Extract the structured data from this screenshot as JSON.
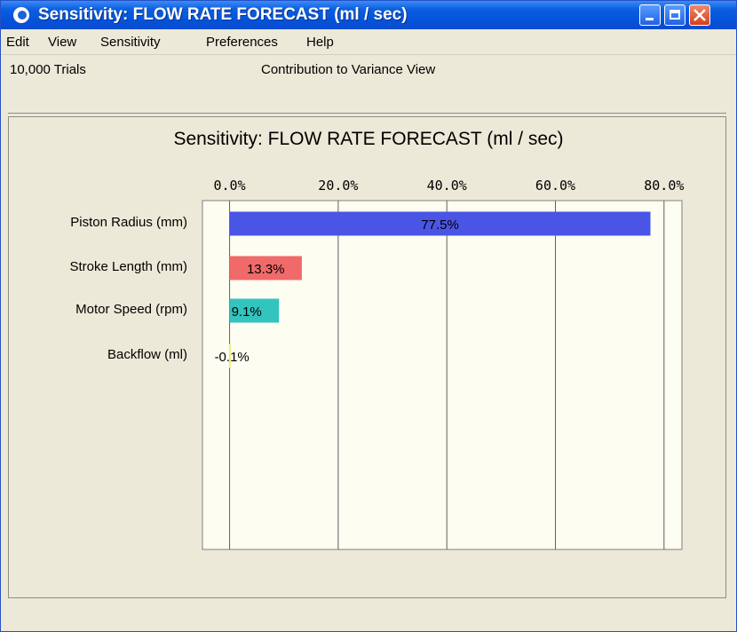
{
  "window": {
    "title": "Sensitivity: FLOW RATE FORECAST (ml / sec)"
  },
  "menu": {
    "items": [
      "Edit",
      "View",
      "Sensitivity",
      "Preferences",
      "Help"
    ]
  },
  "info": {
    "trials": "10,000 Trials",
    "view": "Contribution to Variance View"
  },
  "colors": {
    "bar_piston": "#4a55e6",
    "bar_stroke": "#f06a6a",
    "bar_motor": "#33c4bf",
    "bar_backflow": "#f2f07a",
    "plot_bg": "#fdfdf2"
  },
  "chart_data": {
    "type": "bar",
    "orientation": "horizontal",
    "title": "Sensitivity: FLOW RATE FORECAST (ml / sec)",
    "xlabel": "",
    "ylabel": "",
    "xlim": [
      -5,
      83.3
    ],
    "ticks": [
      0,
      20,
      40,
      60,
      80
    ],
    "tick_labels": [
      "0.0%",
      "20.0%",
      "40.0%",
      "60.0%",
      "80.0%"
    ],
    "categories": [
      "Piston Radius (mm)",
      "Stroke Length (mm)",
      "Motor Speed (rpm)",
      "Backflow (ml)"
    ],
    "values": [
      77.5,
      13.3,
      9.1,
      -0.1
    ],
    "value_labels": [
      "77.5%",
      "13.3%",
      "9.1%",
      "-0.1%"
    ],
    "grid": true
  }
}
